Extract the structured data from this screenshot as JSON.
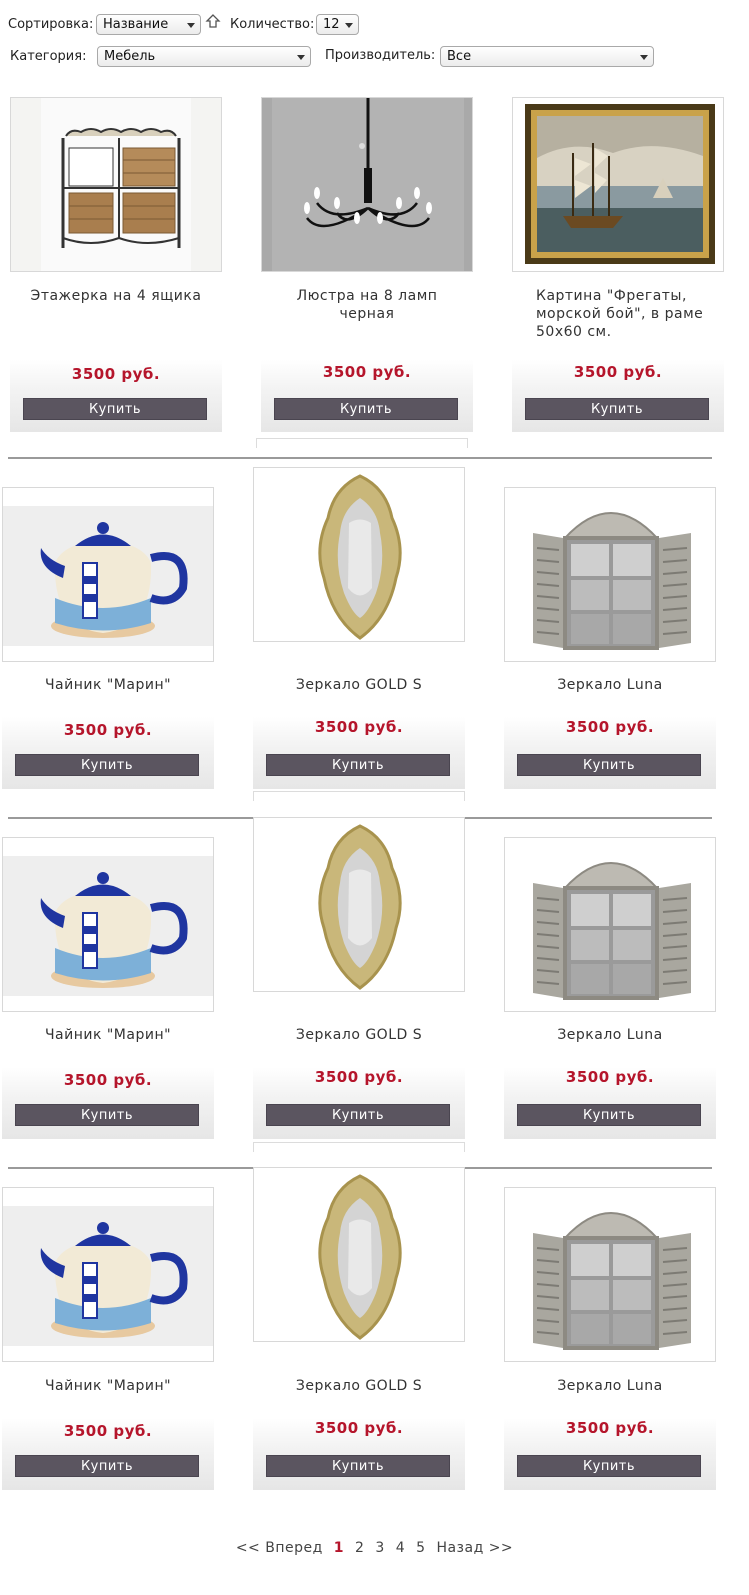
{
  "filters": {
    "sort_label": "Сортировка:",
    "sort_value": "Название",
    "count_label": "Количество:",
    "count_value": "12",
    "category_label": "Категория:",
    "category_value": "Мебель",
    "maker_label": "Производитель:",
    "maker_value": "Все"
  },
  "buy_label": "Купить",
  "rows": [
    [
      {
        "name": "Этажерка на 4 ящика",
        "price": "3500 руб.",
        "image": "shelf"
      },
      {
        "name": "Люстра на 8 ламп черная",
        "price": "3500 руб.",
        "image": "chandelier"
      },
      {
        "name": "Картина \"Фрегаты, морской бой\", в раме 50x60 см.",
        "price": "3500 руб.",
        "image": "painting"
      }
    ],
    [
      {
        "name": "Чайник \"Марин\"",
        "price": "3500 руб.",
        "image": "teapot"
      },
      {
        "name": "Зеркало GOLD S",
        "price": "3500 руб.",
        "image": "mirror"
      },
      {
        "name": "Зеркало Luna",
        "price": "3500 руб.",
        "image": "window-mirror"
      }
    ],
    [
      {
        "name": "Чайник \"Марин\"",
        "price": "3500 руб.",
        "image": "teapot"
      },
      {
        "name": "Зеркало GOLD S",
        "price": "3500 руб.",
        "image": "mirror"
      },
      {
        "name": "Зеркало Luna",
        "price": "3500 руб.",
        "image": "window-mirror"
      }
    ],
    [
      {
        "name": "Чайник \"Марин\"",
        "price": "3500 руб.",
        "image": "teapot"
      },
      {
        "name": "Зеркало GOLD S",
        "price": "3500 руб.",
        "image": "mirror"
      },
      {
        "name": "Зеркало Luna",
        "price": "3500 руб.",
        "image": "window-mirror"
      }
    ]
  ],
  "pagination": {
    "prev": "<< Вперед",
    "pages": [
      "1",
      "2",
      "3",
      "4",
      "5"
    ],
    "current": "1",
    "next": "Назад >>"
  },
  "colors": {
    "price": "#b5152b",
    "button": "#5b5560"
  }
}
